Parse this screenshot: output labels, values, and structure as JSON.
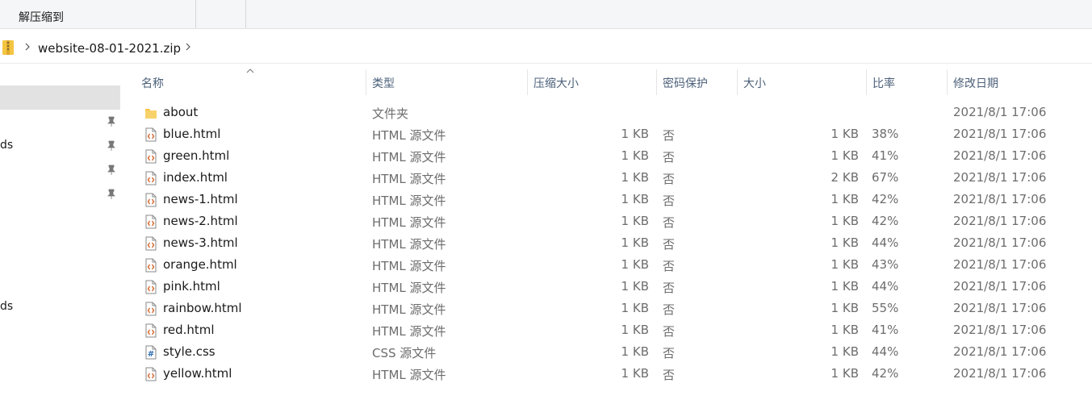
{
  "ribbon": {
    "tab_label": "解压缩到"
  },
  "address": {
    "path": "website-08-01-2021.zip",
    "nav_fragments": [
      "ds",
      "ds"
    ]
  },
  "columns": {
    "name": "名称",
    "type": "类型",
    "compressed": "压缩大小",
    "password": "密码保护",
    "size": "大小",
    "ratio": "比率",
    "modified": "修改日期"
  },
  "files": [
    {
      "name": "about",
      "icon": "folder-icon",
      "type": "文件夹",
      "compressed": "",
      "password": "",
      "size": "",
      "ratio": "",
      "modified": "2021/8/1 17:06"
    },
    {
      "name": "blue.html",
      "icon": "html-file-icon",
      "type": "HTML 源文件",
      "compressed": "1 KB",
      "password": "否",
      "size": "1 KB",
      "ratio": "38%",
      "modified": "2021/8/1 17:06"
    },
    {
      "name": "green.html",
      "icon": "html-file-icon",
      "type": "HTML 源文件",
      "compressed": "1 KB",
      "password": "否",
      "size": "1 KB",
      "ratio": "41%",
      "modified": "2021/8/1 17:06"
    },
    {
      "name": "index.html",
      "icon": "html-file-icon",
      "type": "HTML 源文件",
      "compressed": "1 KB",
      "password": "否",
      "size": "2 KB",
      "ratio": "67%",
      "modified": "2021/8/1 17:06"
    },
    {
      "name": "news-1.html",
      "icon": "html-file-icon",
      "type": "HTML 源文件",
      "compressed": "1 KB",
      "password": "否",
      "size": "1 KB",
      "ratio": "42%",
      "modified": "2021/8/1 17:06"
    },
    {
      "name": "news-2.html",
      "icon": "html-file-icon",
      "type": "HTML 源文件",
      "compressed": "1 KB",
      "password": "否",
      "size": "1 KB",
      "ratio": "42%",
      "modified": "2021/8/1 17:06"
    },
    {
      "name": "news-3.html",
      "icon": "html-file-icon",
      "type": "HTML 源文件",
      "compressed": "1 KB",
      "password": "否",
      "size": "1 KB",
      "ratio": "44%",
      "modified": "2021/8/1 17:06"
    },
    {
      "name": "orange.html",
      "icon": "html-file-icon",
      "type": "HTML 源文件",
      "compressed": "1 KB",
      "password": "否",
      "size": "1 KB",
      "ratio": "43%",
      "modified": "2021/8/1 17:06"
    },
    {
      "name": "pink.html",
      "icon": "html-file-icon",
      "type": "HTML 源文件",
      "compressed": "1 KB",
      "password": "否",
      "size": "1 KB",
      "ratio": "44%",
      "modified": "2021/8/1 17:06"
    },
    {
      "name": "rainbow.html",
      "icon": "html-file-icon",
      "type": "HTML 源文件",
      "compressed": "1 KB",
      "password": "否",
      "size": "1 KB",
      "ratio": "55%",
      "modified": "2021/8/1 17:06"
    },
    {
      "name": "red.html",
      "icon": "html-file-icon",
      "type": "HTML 源文件",
      "compressed": "1 KB",
      "password": "否",
      "size": "1 KB",
      "ratio": "41%",
      "modified": "2021/8/1 17:06"
    },
    {
      "name": "style.css",
      "icon": "css-file-icon",
      "type": "CSS 源文件",
      "compressed": "1 KB",
      "password": "否",
      "size": "1 KB",
      "ratio": "44%",
      "modified": "2021/8/1 17:06"
    },
    {
      "name": "yellow.html",
      "icon": "html-file-icon",
      "type": "HTML 源文件",
      "compressed": "1 KB",
      "password": "否",
      "size": "1 KB",
      "ratio": "42%",
      "modified": "2021/8/1 17:06"
    }
  ],
  "colors": {
    "header_text": "#4c607a",
    "selected_bg": "#e2e2e2",
    "folder": "#f4c542",
    "html_icon": "#d9662a",
    "css_icon": "#2b6cb0"
  }
}
